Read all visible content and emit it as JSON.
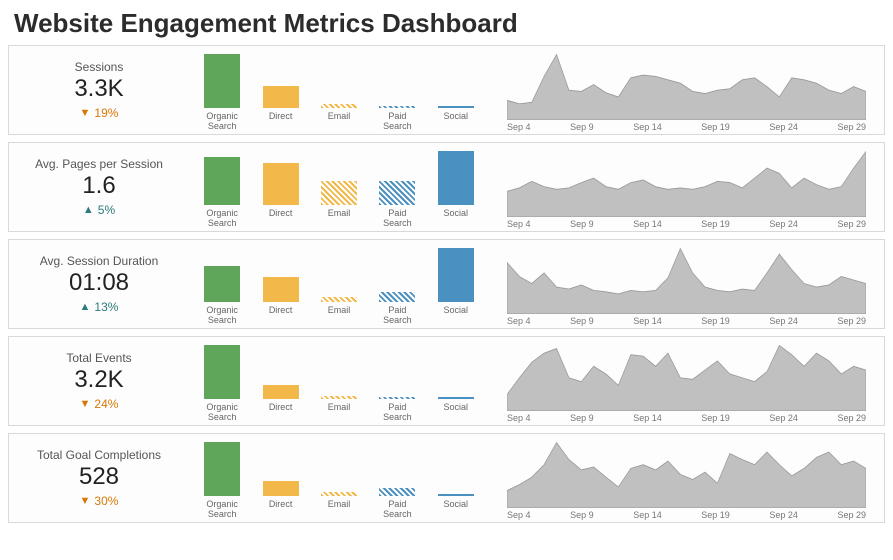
{
  "title": "Website Engagement Metrics Dashboard",
  "channel_labels": [
    "Organic\nSearch",
    "Direct",
    "Email",
    "Paid\nSearch",
    "Social"
  ],
  "date_ticks": [
    "Sep 4",
    "Sep 9",
    "Sep 14",
    "Sep 19",
    "Sep 24",
    "Sep 29"
  ],
  "metrics": [
    {
      "id": "sessions",
      "label": "Sessions",
      "value": "3.3K",
      "delta_dir": "down",
      "delta": "19%"
    },
    {
      "id": "pps",
      "label": "Avg. Pages per Session",
      "value": "1.6",
      "delta_dir": "up",
      "delta": "5%"
    },
    {
      "id": "duration",
      "label": "Avg. Session Duration",
      "value": "01:08",
      "delta_dir": "up",
      "delta": "13%"
    },
    {
      "id": "events",
      "label": "Total Events",
      "value": "3.2K",
      "delta_dir": "down",
      "delta": "24%"
    },
    {
      "id": "goals",
      "label": "Total Goal Completions",
      "value": "528",
      "delta_dir": "down",
      "delta": "30%"
    }
  ],
  "chart_data": [
    {
      "metric": "Sessions",
      "type": "bar",
      "categories": [
        "Organic Search",
        "Direct",
        "Email",
        "Paid Search",
        "Social"
      ],
      "values": [
        100,
        40,
        8,
        3,
        2
      ]
    },
    {
      "metric": "Sessions",
      "type": "area",
      "x_range": "Sep 1 – Sep 30",
      "values": [
        25,
        20,
        22,
        60,
        92,
        40,
        38,
        48,
        36,
        30,
        58,
        62,
        60,
        55,
        50,
        38,
        35,
        40,
        42,
        55,
        58,
        45,
        30,
        58,
        55,
        50,
        40,
        35,
        45,
        38
      ]
    },
    {
      "metric": "Avg. Pages per Session",
      "type": "bar",
      "categories": [
        "Organic Search",
        "Direct",
        "Email",
        "Paid Search",
        "Social"
      ],
      "values": [
        88,
        78,
        44,
        44,
        100
      ]
    },
    {
      "metric": "Avg. Pages per Session",
      "type": "area",
      "x_range": "Sep 1 – Sep 30",
      "values": [
        35,
        40,
        50,
        42,
        38,
        40,
        48,
        55,
        42,
        38,
        48,
        52,
        42,
        38,
        40,
        38,
        42,
        50,
        48,
        40,
        55,
        70,
        62,
        40,
        55,
        45,
        38,
        42,
        70,
        95
      ]
    },
    {
      "metric": "Avg. Session Duration",
      "type": "bar",
      "categories": [
        "Organic Search",
        "Direct",
        "Email",
        "Paid Search",
        "Social"
      ],
      "values": [
        66,
        46,
        10,
        18,
        100
      ]
    },
    {
      "metric": "Avg. Session Duration",
      "type": "area",
      "x_range": "Sep 1 – Sep 30",
      "values": [
        70,
        50,
        40,
        55,
        35,
        32,
        38,
        30,
        28,
        25,
        30,
        28,
        30,
        48,
        90,
        55,
        35,
        30,
        28,
        32,
        30,
        55,
        82,
        60,
        40,
        35,
        38,
        50,
        45,
        40
      ]
    },
    {
      "metric": "Total Events",
      "type": "bar",
      "categories": [
        "Organic Search",
        "Direct",
        "Email",
        "Paid Search",
        "Social"
      ],
      "values": [
        100,
        26,
        6,
        4,
        2
      ]
    },
    {
      "metric": "Total Events",
      "type": "area",
      "x_range": "Sep 1 – Sep 30",
      "values": [
        18,
        40,
        60,
        72,
        78,
        40,
        35,
        55,
        45,
        30,
        70,
        68,
        55,
        72,
        40,
        38,
        50,
        62,
        45,
        40,
        35,
        48,
        82,
        70,
        55,
        72,
        62,
        45,
        55,
        50
      ]
    },
    {
      "metric": "Total Goal Completions",
      "type": "bar",
      "categories": [
        "Organic Search",
        "Direct",
        "Email",
        "Paid Search",
        "Social"
      ],
      "values": [
        100,
        28,
        8,
        14,
        2
      ]
    },
    {
      "metric": "Total Goal Completions",
      "type": "area",
      "x_range": "Sep 1 – Sep 30",
      "values": [
        20,
        28,
        38,
        55,
        85,
        62,
        48,
        52,
        38,
        25,
        50,
        55,
        48,
        60,
        42,
        35,
        45,
        30,
        70,
        62,
        55,
        72,
        55,
        40,
        50,
        65,
        72,
        55,
        60,
        50
      ]
    }
  ]
}
